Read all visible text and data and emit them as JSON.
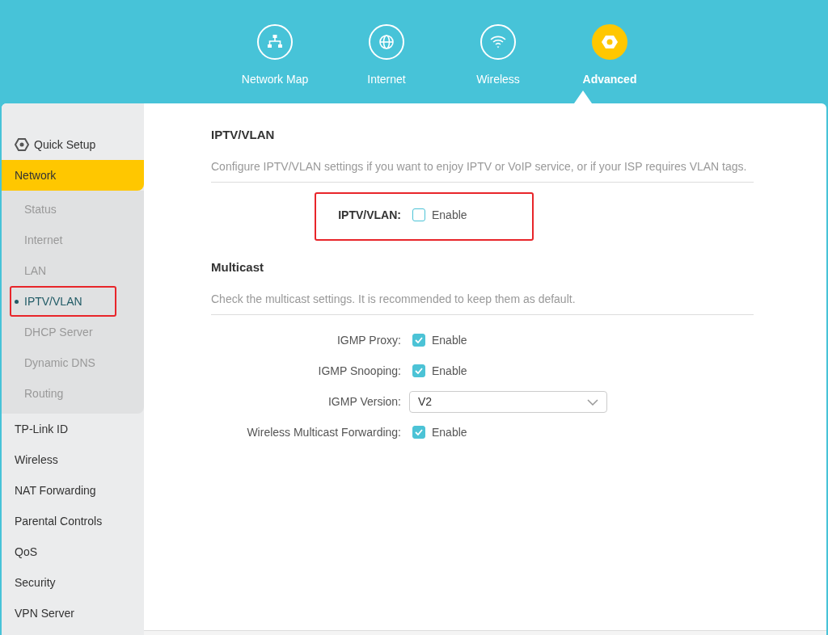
{
  "top_nav": [
    {
      "label": "Network Map",
      "selected": false
    },
    {
      "label": "Internet",
      "selected": false
    },
    {
      "label": "Wireless",
      "selected": false
    },
    {
      "label": "Advanced",
      "selected": true
    }
  ],
  "sidebar": {
    "items": [
      {
        "label": "Quick Setup",
        "kind": "setup",
        "selected": false
      },
      {
        "label": "Network",
        "kind": "menu",
        "selected": true,
        "expanded": true,
        "children": [
          {
            "label": "Status",
            "selected": false,
            "highlighted": false
          },
          {
            "label": "Internet",
            "selected": false,
            "highlighted": false
          },
          {
            "label": "LAN",
            "selected": false,
            "highlighted": false
          },
          {
            "label": "IPTV/VLAN",
            "selected": true,
            "highlighted": true
          },
          {
            "label": "DHCP Server",
            "selected": false,
            "highlighted": false
          },
          {
            "label": "Dynamic DNS",
            "selected": false,
            "highlighted": false
          },
          {
            "label": "Routing",
            "selected": false,
            "highlighted": false
          }
        ]
      },
      {
        "label": "TP-Link ID",
        "kind": "menu",
        "selected": false
      },
      {
        "label": "Wireless",
        "kind": "menu",
        "selected": false
      },
      {
        "label": "NAT Forwarding",
        "kind": "menu",
        "selected": false
      },
      {
        "label": "Parental Controls",
        "kind": "menu",
        "selected": false
      },
      {
        "label": "QoS",
        "kind": "menu",
        "selected": false
      },
      {
        "label": "Security",
        "kind": "menu",
        "selected": false
      },
      {
        "label": "VPN Server",
        "kind": "menu",
        "selected": false
      }
    ]
  },
  "sections": [
    {
      "title": "IPTV/VLAN",
      "description": "Configure IPTV/VLAN settings if you want to enjoy IPTV or VoIP service, or if your ISP requires VLAN tags.",
      "rows": [
        {
          "label": "IPTV/VLAN:",
          "kind": "checkbox",
          "checked": false,
          "option": "Enable",
          "emphasized": true,
          "highlighted": true
        }
      ]
    },
    {
      "title": "Multicast",
      "description": "Check the multicast settings. It is recommended to keep them as default.",
      "rows": [
        {
          "label": "IGMP Proxy:",
          "kind": "checkbox",
          "checked": true,
          "option": "Enable",
          "emphasized": false,
          "highlighted": false
        },
        {
          "label": "IGMP Snooping:",
          "kind": "checkbox",
          "checked": true,
          "option": "Enable",
          "emphasized": false,
          "highlighted": false
        },
        {
          "label": "IGMP Version:",
          "kind": "select",
          "value": "V2",
          "emphasized": false,
          "highlighted": false
        },
        {
          "label": "Wireless Multicast Forwarding:",
          "kind": "checkbox",
          "checked": true,
          "option": "Enable",
          "emphasized": false,
          "highlighted": false
        }
      ]
    }
  ]
}
